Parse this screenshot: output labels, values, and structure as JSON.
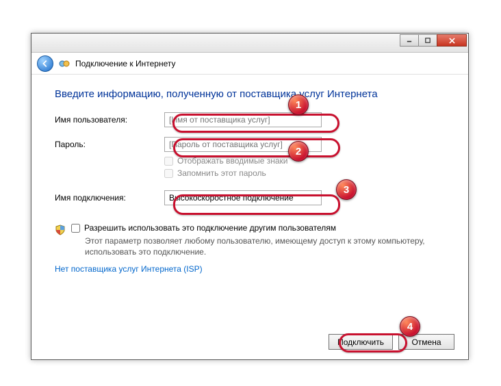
{
  "window": {
    "title": "Подключение к Интернету"
  },
  "heading": "Введите информацию, полученную от поставщика услуг Интернета",
  "fields": {
    "username": {
      "label": "Имя пользователя:",
      "placeholder": "[Имя от поставщика услуг]"
    },
    "password": {
      "label": "Пароль:",
      "placeholder": "[Пароль от поставщика услуг]"
    },
    "show_chars": {
      "label": "Отображать вводимые знаки"
    },
    "remember": {
      "label": "Запомнить этот пароль"
    },
    "conn_name": {
      "label": "Имя подключения:",
      "value": "Высокоскоростное подключение"
    }
  },
  "permission": {
    "label": "Разрешить использовать это подключение другим пользователям",
    "desc": "Этот параметр позволяет любому пользователю, имеющему доступ к этому компьютеру, использовать это подключение."
  },
  "isp_link": "Нет поставщика услуг Интернета (ISP)",
  "buttons": {
    "connect": "Подключить",
    "cancel": "Отмена"
  },
  "markers": {
    "1": "1",
    "2": "2",
    "3": "3",
    "4": "4"
  }
}
